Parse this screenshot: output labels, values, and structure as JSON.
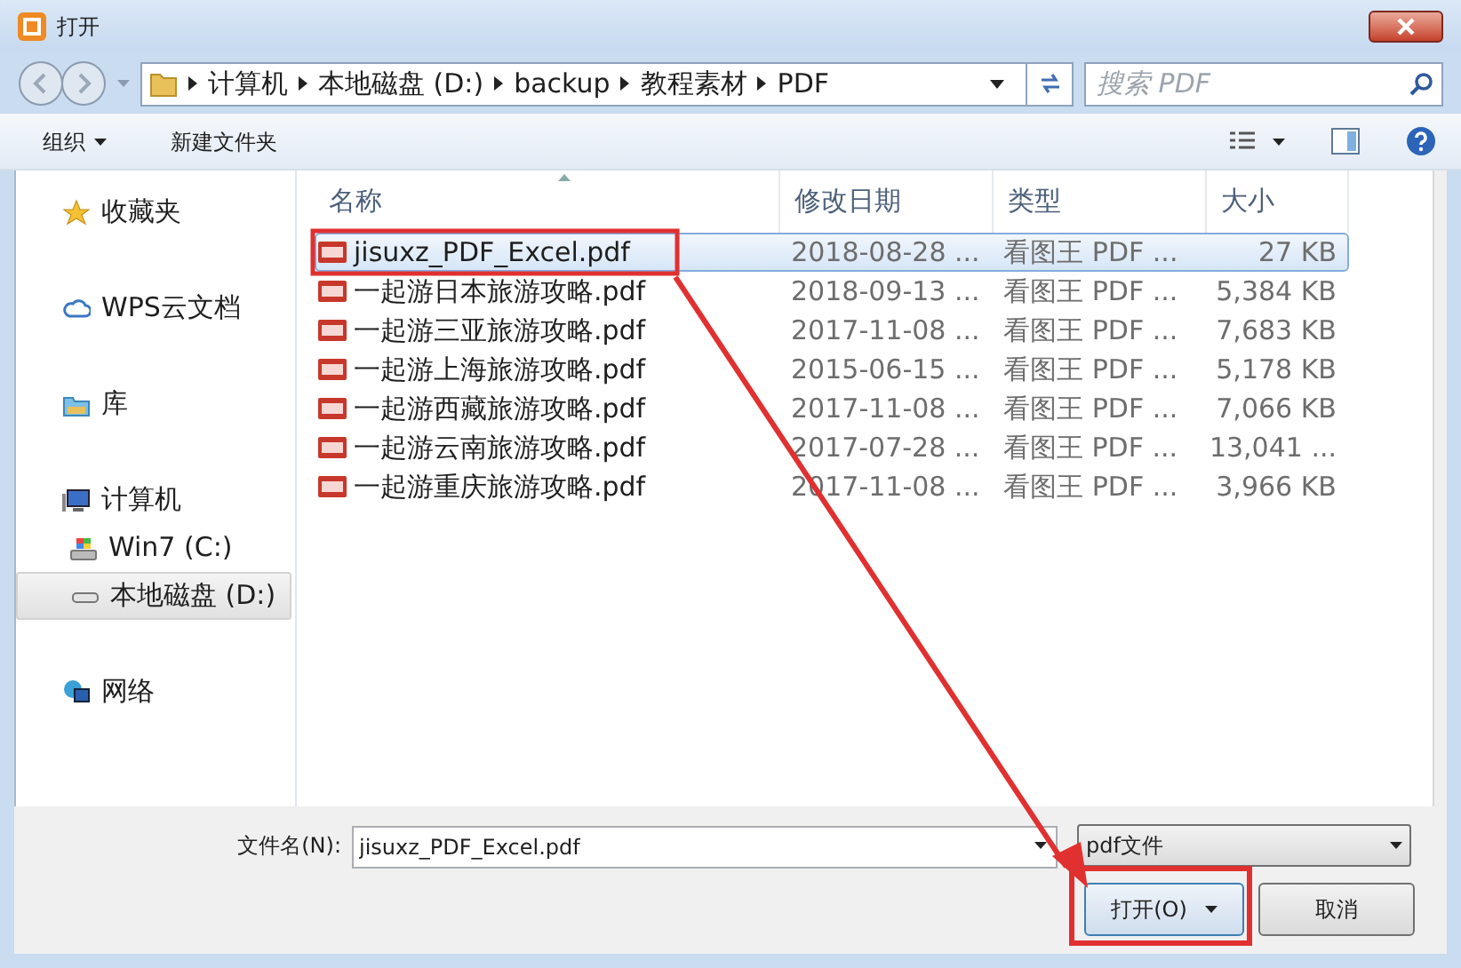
{
  "window": {
    "title": "打开"
  },
  "address": {
    "crumbs": [
      "计算机",
      "本地磁盘 (D:)",
      "backup",
      "教程素材",
      "PDF"
    ]
  },
  "search": {
    "placeholder": "搜索 PDF"
  },
  "toolbar": {
    "organize": "组织",
    "new_folder": "新建文件夹"
  },
  "sidebar": {
    "items": [
      {
        "label": "收藏夹",
        "kind": "star",
        "selected": false
      },
      {
        "label": "WPS云文档",
        "kind": "cloud",
        "selected": false
      },
      {
        "label": "库",
        "kind": "library",
        "selected": false
      },
      {
        "label": "计算机",
        "kind": "computer",
        "selected": false,
        "children": [
          {
            "label": "Win7 (C:)",
            "kind": "sysdrive",
            "selected": false
          },
          {
            "label": "本地磁盘 (D:)",
            "kind": "drive",
            "selected": true
          }
        ]
      },
      {
        "label": "网络",
        "kind": "network",
        "selected": false
      }
    ]
  },
  "table": {
    "columns": [
      "名称",
      "修改日期",
      "类型",
      "大小"
    ],
    "rows": [
      {
        "name": "jisuxz_PDF_Excel.pdf",
        "date": "2018-08-28 ...",
        "type": "看图王 PDF ...",
        "size": "27 KB",
        "selected": true
      },
      {
        "name": "一起游日本旅游攻略.pdf",
        "date": "2018-09-13 ...",
        "type": "看图王 PDF ...",
        "size": "5,384 KB",
        "selected": false
      },
      {
        "name": "一起游三亚旅游攻略.pdf",
        "date": "2017-11-08 ...",
        "type": "看图王 PDF ...",
        "size": "7,683 KB",
        "selected": false
      },
      {
        "name": "一起游上海旅游攻略.pdf",
        "date": "2015-06-15 ...",
        "type": "看图王 PDF ...",
        "size": "5,178 KB",
        "selected": false
      },
      {
        "name": "一起游西藏旅游攻略.pdf",
        "date": "2017-11-08 ...",
        "type": "看图王 PDF ...",
        "size": "7,066 KB",
        "selected": false
      },
      {
        "name": "一起游云南旅游攻略.pdf",
        "date": "2017-07-28 ...",
        "type": "看图王 PDF ...",
        "size": "13,041 ...",
        "selected": false
      },
      {
        "name": "一起游重庆旅游攻略.pdf",
        "date": "2017-11-08 ...",
        "type": "看图王 PDF ...",
        "size": "3,966 KB",
        "selected": false
      }
    ]
  },
  "footer": {
    "filename_label": "文件名(N):",
    "filename": "jisuxz_PDF_Excel.pdf",
    "filter": "pdf文件",
    "open": "打开(O)",
    "cancel": "取消"
  }
}
